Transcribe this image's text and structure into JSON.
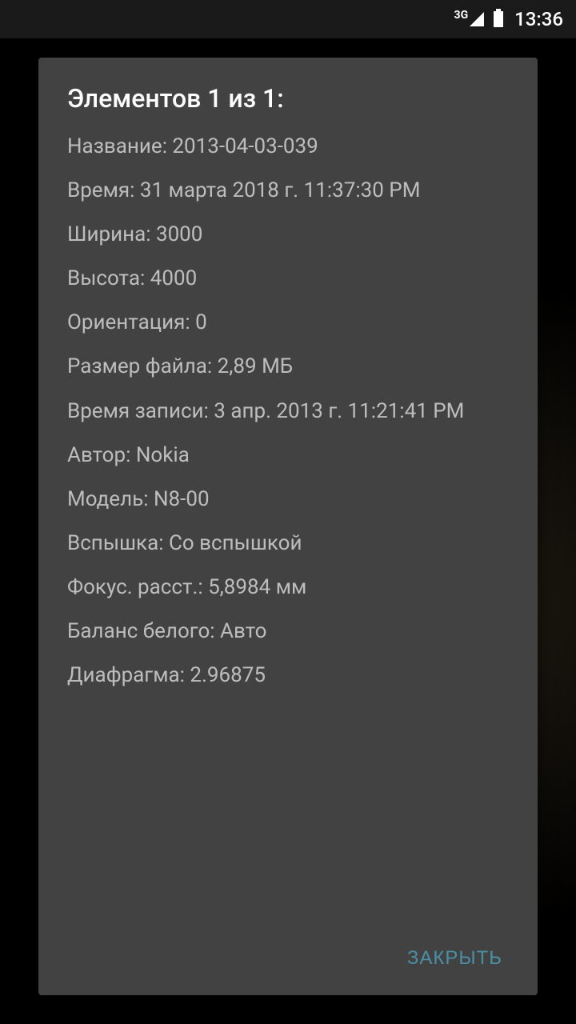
{
  "status": {
    "network": "3G",
    "time": "13:36"
  },
  "dialog": {
    "title": "Элементов 1 из 1:",
    "details": {
      "name": "Название: 2013-04-03-039",
      "time": "Время: 31 марта 2018 г. 11:37:30 PM",
      "width": "Ширина: 3000",
      "height": "Высота: 4000",
      "orientation": "Ориентация: 0",
      "filesize": "Размер файла: 2,89 МБ",
      "record_time": "Время записи: 3 апр. 2013 г. 11:21:41 PM",
      "author": "Автор: Nokia",
      "model": "Модель: N8-00",
      "flash": "Вспышка: Со вспышкой",
      "focal": "Фокус. расст.: 5,8984 мм",
      "wb": "Баланс белого: Авто",
      "aperture": "Диафрагма: 2.96875"
    },
    "close": "Закрыть"
  }
}
